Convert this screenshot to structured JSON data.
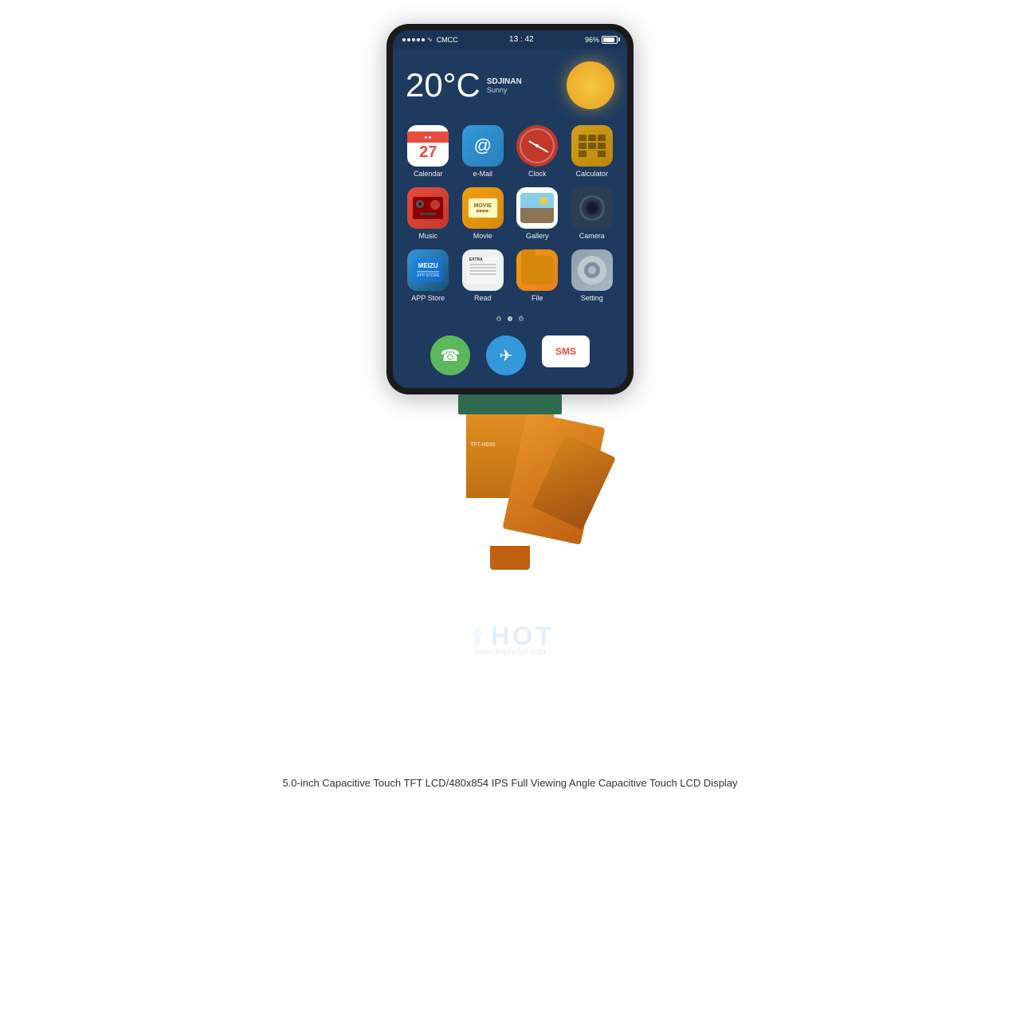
{
  "page": {
    "background_color": "#ffffff",
    "caption": "5.0-inch Capacitive Touch TFT LCD/480x854 IPS Full Viewing Angle Capacitive Touch LCD Display"
  },
  "phone": {
    "status_bar": {
      "carrier": "CMCC",
      "signal_dots": 5,
      "time": "13 : 42",
      "battery_percent": "96%"
    },
    "weather": {
      "temperature": "20°C",
      "city": "SDJINAN",
      "condition": "Sunny"
    },
    "apps": [
      {
        "id": "calendar",
        "label": "Calendar",
        "day": "27"
      },
      {
        "id": "email",
        "label": "e-Mail"
      },
      {
        "id": "clock",
        "label": "Clock"
      },
      {
        "id": "calculator",
        "label": "Calculator"
      },
      {
        "id": "music",
        "label": "Music"
      },
      {
        "id": "movie",
        "label": "Movie"
      },
      {
        "id": "gallery",
        "label": "Gallery"
      },
      {
        "id": "camera",
        "label": "Camera"
      },
      {
        "id": "appstore",
        "label": "APP Store"
      },
      {
        "id": "read",
        "label": "Read"
      },
      {
        "id": "file",
        "label": "File"
      },
      {
        "id": "setting",
        "label": "Setting"
      }
    ],
    "page_dots": [
      "A",
      "◯",
      "B"
    ],
    "nav": [
      {
        "id": "phone",
        "label": "☎"
      },
      {
        "id": "plane",
        "label": "✈"
      },
      {
        "id": "sms",
        "label": "SMS"
      }
    ]
  },
  "watermark": {
    "logo": "HOT",
    "url": "www.displaylcd.com"
  },
  "fpc": {
    "label": "TFT-H050"
  }
}
